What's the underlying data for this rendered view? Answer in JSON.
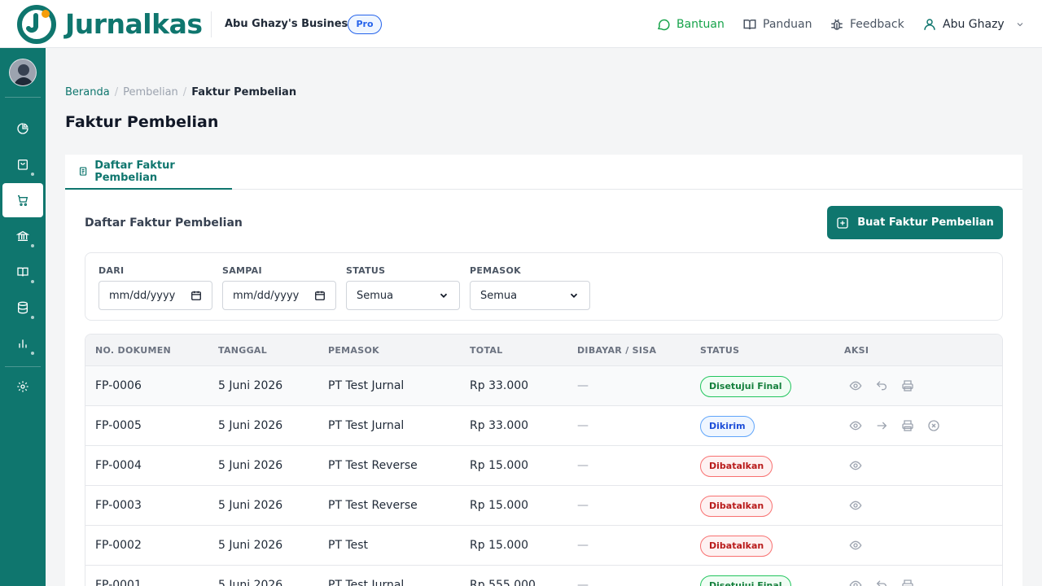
{
  "brand": {
    "name": "Jurnalkas",
    "business": "Abu Ghazy's Business",
    "plan": "Pro"
  },
  "topnav": {
    "help": "Bantuan",
    "guide": "Panduan",
    "feedback": "Feedback",
    "user": "Abu Ghazy"
  },
  "breadcrumb": {
    "home": "Beranda",
    "parent": "Pembelian",
    "current": "Faktur Pembelian"
  },
  "page": {
    "title": "Faktur Pembelian",
    "tab": "Daftar Faktur Pembelian",
    "card_title": "Daftar Faktur Pembelian",
    "create_button": "Buat Faktur Pembelian"
  },
  "filters": {
    "from": {
      "label": "DARI",
      "value": "mm/dd/yyyy"
    },
    "to": {
      "label": "SAMPAI",
      "value": "mm/dd/yyyy"
    },
    "status": {
      "label": "STATUS",
      "value": "Semua"
    },
    "supplier": {
      "label": "PEMASOK",
      "value": "Semua"
    }
  },
  "table": {
    "headers": [
      "NO. DOKUMEN",
      "TANGGAL",
      "PEMASOK",
      "TOTAL",
      "DIBAYAR / SISA",
      "STATUS",
      "AKSI"
    ],
    "rows": [
      {
        "doc": "FP-0006",
        "date": "5 Juni 2026",
        "supplier": "PT Test Jurnal",
        "total": "Rp 33.000",
        "paid": "—",
        "status": "Disetujui Final",
        "status_kind": "final",
        "actions": [
          "eye-icon",
          "undo-icon",
          "print-icon"
        ]
      },
      {
        "doc": "FP-0005",
        "date": "5 Juni 2026",
        "supplier": "PT Test Jurnal",
        "total": "Rp 33.000",
        "paid": "—",
        "status": "Dikirim",
        "status_kind": "sent",
        "actions": [
          "eye-icon",
          "arrow-right-icon",
          "print-icon",
          "cancel-icon"
        ]
      },
      {
        "doc": "FP-0004",
        "date": "5 Juni 2026",
        "supplier": "PT Test Reverse",
        "total": "Rp 15.000",
        "paid": "—",
        "status": "Dibatalkan",
        "status_kind": "cancel",
        "actions": [
          "eye-icon"
        ]
      },
      {
        "doc": "FP-0003",
        "date": "5 Juni 2026",
        "supplier": "PT Test Reverse",
        "total": "Rp 15.000",
        "paid": "—",
        "status": "Dibatalkan",
        "status_kind": "cancel",
        "actions": [
          "eye-icon"
        ]
      },
      {
        "doc": "FP-0002",
        "date": "5 Juni 2026",
        "supplier": "PT Test",
        "total": "Rp 15.000",
        "paid": "—",
        "status": "Dibatalkan",
        "status_kind": "cancel",
        "actions": [
          "eye-icon"
        ]
      },
      {
        "doc": "FP-0001",
        "date": "5 Juni 2026",
        "supplier": "PT Test Jurnal",
        "total": "Rp 555.000",
        "paid": "—",
        "status": "Disetujui Final",
        "status_kind": "final",
        "actions": [
          "eye-icon",
          "undo-icon",
          "print-icon"
        ]
      }
    ]
  },
  "colors": {
    "brand": "#0f766e",
    "help": "#16a34a",
    "final": "#15803d",
    "sent": "#1d4ed8",
    "cancel": "#b91c1c"
  }
}
